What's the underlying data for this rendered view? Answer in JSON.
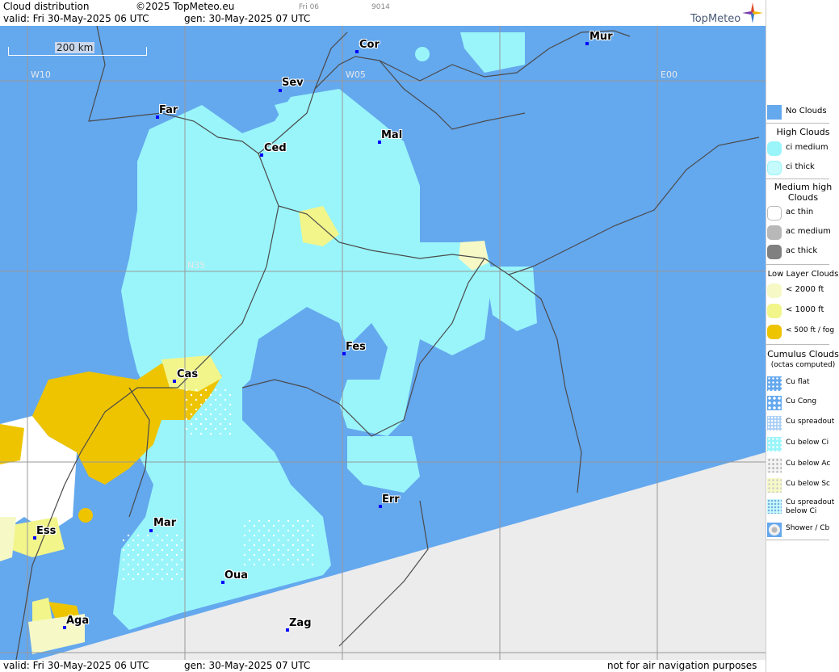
{
  "header": {
    "title": "Cloud distribution",
    "copyright": "©2025 TopMeteo.eu",
    "valid": "valid:  Fri  30-May-2025  06 UTC",
    "gen": "gen: 30-May-2025 07 UTC",
    "small_day": "Fri 06",
    "small_code": "9014",
    "brand": "TopMeteo"
  },
  "map": {
    "scale_label": "200 km",
    "grid_labels": {
      "w10": "W10",
      "w05": "W05",
      "e00": "E00",
      "n35": "N35"
    },
    "cities": {
      "cor": "Cor",
      "mur": "Mur",
      "sev": "Sev",
      "far": "Far",
      "mal": "Mal",
      "ced": "Ced",
      "fes": "Fes",
      "cas": "Cas",
      "err": "Err",
      "mar": "Mar",
      "ess": "Ess",
      "oua": "Oua",
      "aga": "Aga",
      "zag": "Zag"
    },
    "colors": {
      "no_clouds": "#64a8ee",
      "ci": "#99f5fa",
      "low2000": "#f6f9c6",
      "low1000": "#f2f58a",
      "fog": "#eec400",
      "nodata": "#ececec",
      "acthin": "#ffffff"
    }
  },
  "footer": {
    "valid": "valid:  Fri  30-May-2025  06 UTC",
    "gen": "gen: 30-May-2025 07 UTC",
    "disclaimer": "not for air navigation purposes"
  },
  "legend": {
    "no_clouds": "No Clouds",
    "high_head": "High Clouds",
    "ci_medium": "ci medium",
    "ci_thick": "ci thick",
    "medium_head": "Medium high Clouds",
    "ac_thin": "ac thin",
    "ac_medium": "ac medium",
    "ac_thick": "ac thick",
    "low_head": "Low Layer Clouds",
    "low2000": "< 2000 ft",
    "low1000": "< 1000 ft",
    "fog": "< 500 ft / fog",
    "cu_head": "Cumulus Clouds",
    "cu_sub": "(octas computed)",
    "cu_flat": "Cu flat",
    "cu_cong": "Cu Cong",
    "cu_spread": "Cu spreadout",
    "cu_below_ci": "Cu below Ci",
    "cu_below_ac": "Cu below Ac",
    "cu_below_sc": "Cu below Sc",
    "cu_spread_ci": "Cu spreadout below Ci",
    "shower": "Shower / Cb"
  }
}
